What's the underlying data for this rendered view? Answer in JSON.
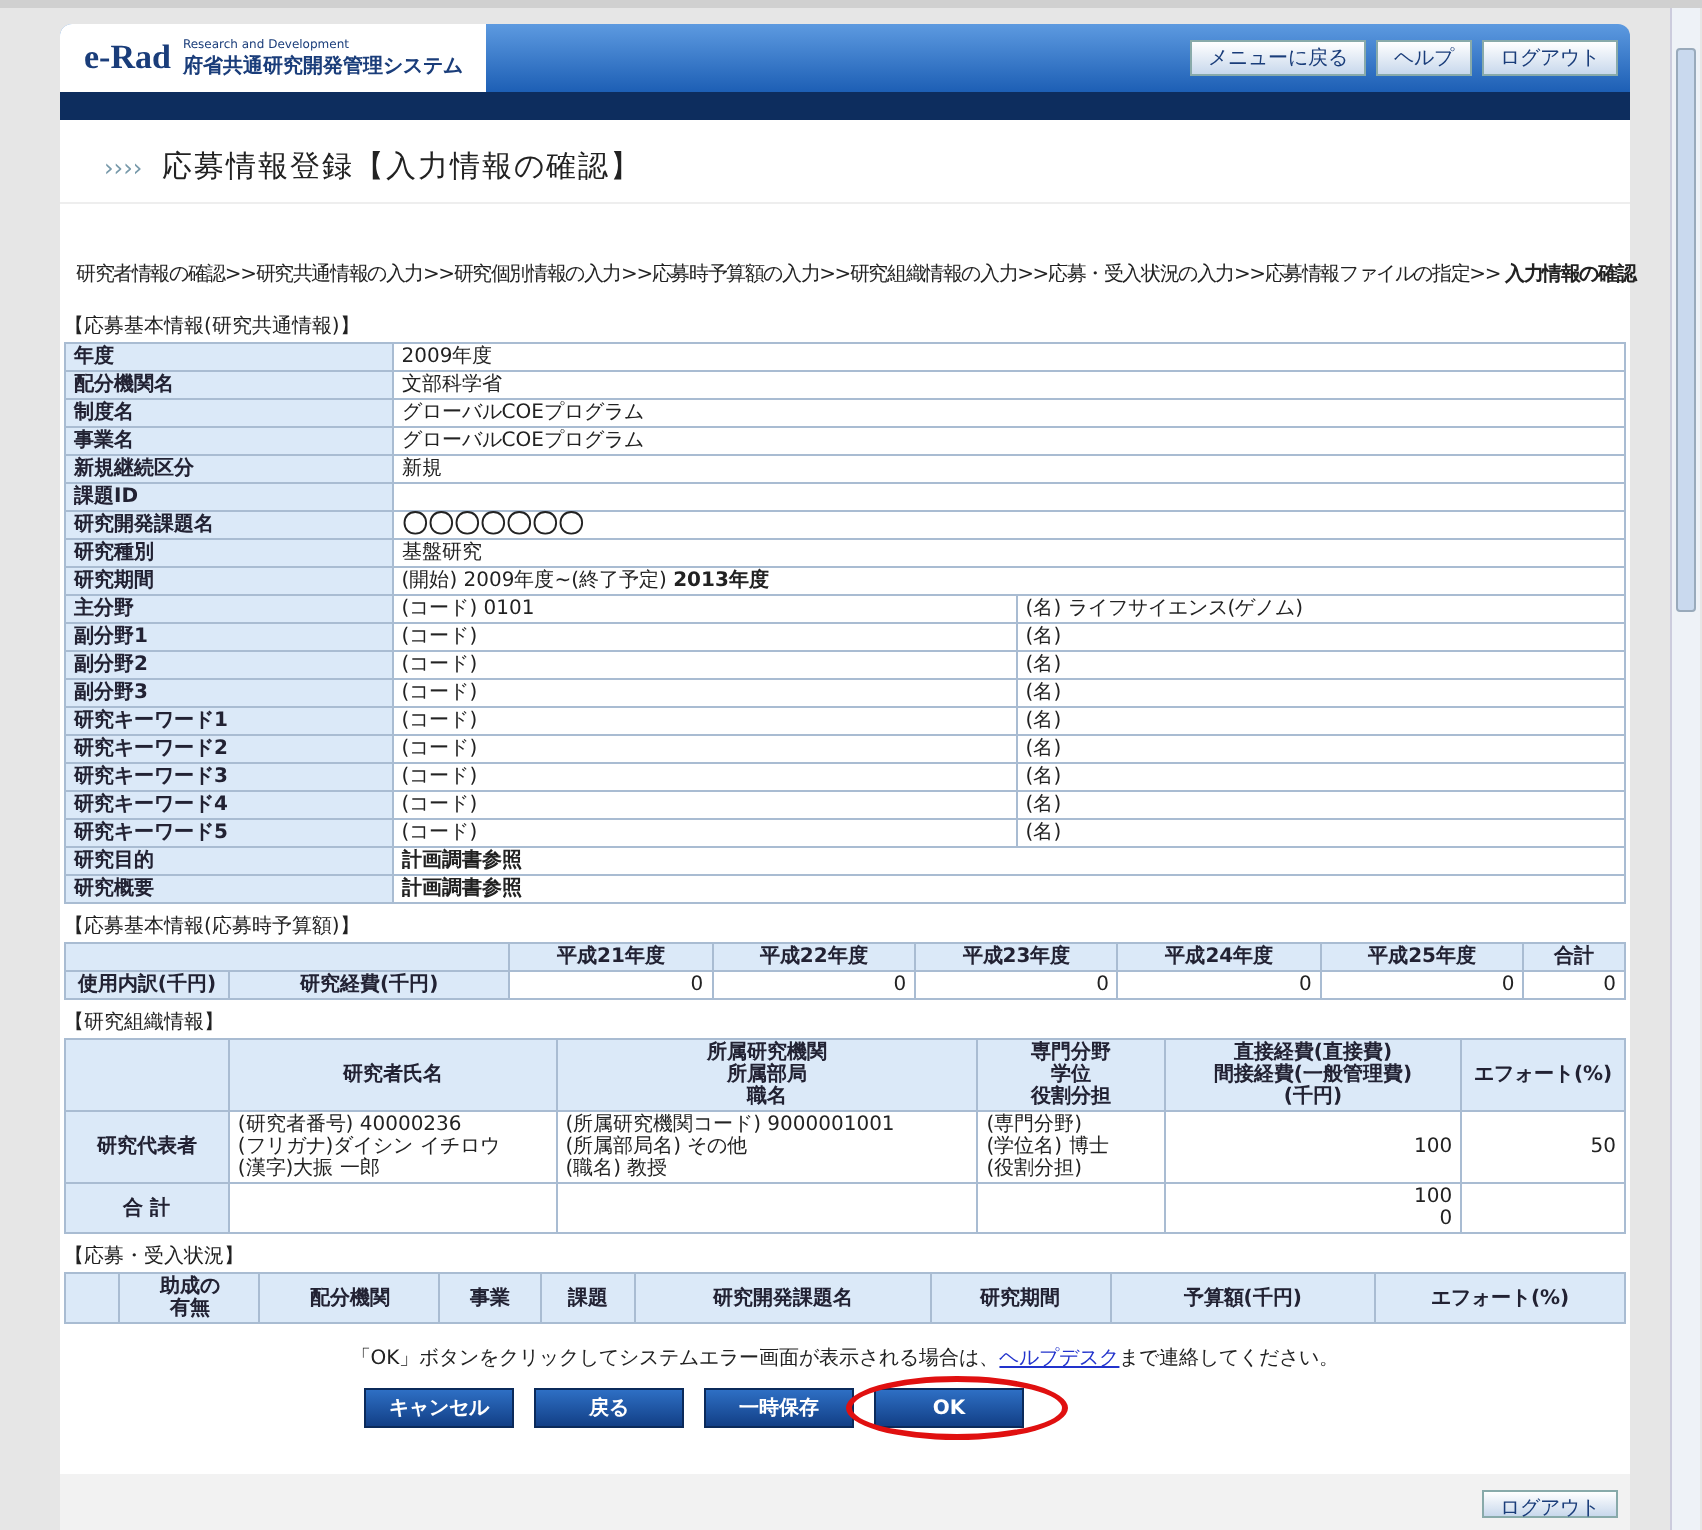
{
  "header": {
    "logo_mark": "e-Rad",
    "logo_tagline": "Research and Development",
    "logo_name": "府省共通研究開発管理システム",
    "nav_buttons": [
      "メニューに戻る",
      "ヘルプ",
      "ログアウト"
    ]
  },
  "title": {
    "prefix": "››››",
    "text": "応募情報登録【入力情報の確認】"
  },
  "breadcrumb": "研究者情報の確認>>研究共通情報の入力>>研究個別情報の入力>>応募時予算額の入力>>研究組織情報の入力>>応募・受入状況の入力>>応募情報ファイルの指定>> **入力情報の確認**",
  "basic_info": {
    "heading": "【応募基本情報(研究共通情報)】",
    "rows": [
      {
        "kind": "single",
        "label": "年度",
        "value": "2009年度"
      },
      {
        "kind": "single",
        "label": "配分機関名",
        "value": "文部科学省"
      },
      {
        "kind": "single",
        "label": "制度名",
        "value": "グローバルCOEプログラム"
      },
      {
        "kind": "single",
        "label": "事業名",
        "value": "グローバルCOEプログラム"
      },
      {
        "kind": "single",
        "label": "新規継続区分",
        "value": "新規"
      },
      {
        "kind": "single",
        "label": "課題ID"
      },
      {
        "kind": "single",
        "label": "研究開発課題名",
        "value": "〇〇〇〇〇〇〇",
        "bold": true,
        "large": true
      },
      {
        "kind": "single",
        "label": "研究種別",
        "value": "基盤研究"
      },
      {
        "kind": "single",
        "label": "研究期間",
        "value": "(開始) 2009年度~(終了予定) **2013年度**"
      },
      {
        "kind": "pair",
        "label": "主分野",
        "value": "(コード) 0101",
        "value_2": "(名) ライフサイエンス(ゲノム)"
      },
      {
        "kind": "pair",
        "label": "副分野1",
        "value": "(コード)",
        "value_2": "(名)"
      },
      {
        "kind": "pair",
        "label": "副分野2",
        "value": "(コード)",
        "value_2": "(名)"
      },
      {
        "kind": "pair",
        "label": "副分野3",
        "value": "(コード)",
        "value_2": "(名)"
      },
      {
        "kind": "pair",
        "label": "研究キーワード1",
        "value": "(コード)",
        "value_2": "(名)"
      },
      {
        "kind": "pair",
        "label": "研究キーワード2",
        "value": "(コード)",
        "value_2": "(名)"
      },
      {
        "kind": "pair",
        "label": "研究キーワード3",
        "value": "(コード)",
        "value_2": "(名)"
      },
      {
        "kind": "pair",
        "label": "研究キーワード4",
        "value": "(コード)",
        "value_2": "(名)"
      },
      {
        "kind": "pair",
        "label": "研究キーワード5",
        "value": "(コード)",
        "value_2": "(名)"
      },
      {
        "kind": "single",
        "label": "研究目的",
        "value": "計画調書参照",
        "bold": true
      },
      {
        "kind": "single",
        "label": "研究概要",
        "value": "計画調書参照",
        "bold": true
      }
    ]
  },
  "budget": {
    "heading": "【応募基本情報(応募時予算額)】",
    "columns": [
      "平成21年度",
      "平成22年度",
      "平成23年度",
      "平成24年度",
      "平成25年度",
      "合計"
    ],
    "row": {
      "label": "使用内訳(千円)",
      "sublabel": "研究経費(千円)",
      "values": [
        "0",
        "0",
        "0",
        "0",
        "0",
        "0"
      ]
    }
  },
  "organization": {
    "heading": "【研究組織情報】",
    "columns": [
      {
        "lines": [
          "研究者氏名"
        ]
      },
      {
        "lines": [
          "所属研究機関",
          "所属部局",
          "職名"
        ]
      },
      {
        "lines": [
          "専門分野",
          "学位",
          "役割分担"
        ]
      },
      {
        "lines": [
          "直接経費(直接費)",
          "間接経費(一般管理費)",
          "(千円)"
        ]
      },
      {
        "lines": [
          "エフォート(%)"
        ]
      }
    ],
    "rows": [
      {
        "label": "研究代表者",
        "name": [
          "(研究者番号) 40000236",
          "(フリガナ)ダイシン イチロウ",
          "(漢字)大振 一郎"
        ],
        "affiliation": [
          "(所属研究機関コード) 9000001001",
          "(所属部局名) その他",
          "(職名) 教授"
        ],
        "field": [
          "(専門分野)",
          "(学位名) 博士",
          "(役割分担)"
        ],
        "cost": [
          "100"
        ],
        "effort": [
          "50"
        ]
      },
      {
        "label": "合 計",
        "cost": [
          "100",
          "0"
        ]
      }
    ]
  },
  "status": {
    "heading": "【応募・受入状況】",
    "columns": [
      {
        "lines": [
          "助成の",
          "有無"
        ]
      },
      {
        "lines": [
          "配分機関"
        ]
      },
      {
        "lines": [
          "事業"
        ]
      },
      {
        "lines": [
          "課題"
        ]
      },
      {
        "lines": [
          "研究開発課題名"
        ]
      },
      {
        "lines": [
          "研究期間"
        ]
      },
      {
        "lines": [
          "予算額(千円)"
        ]
      },
      {
        "lines": [
          "エフォート(%)"
        ]
      }
    ]
  },
  "note": {
    "before": "「OK」ボタンをクリックしてシステムエラー画面が表示される場合は、",
    "link": "ヘルプデスク",
    "after": "まで連絡してください。"
  },
  "buttons": [
    {
      "label": "キャンセル",
      "highlighted": false
    },
    {
      "label": "戻る",
      "highlighted": false
    },
    {
      "label": "一時保存",
      "highlighted": false
    },
    {
      "label": "OK",
      "highlighted": true
    }
  ],
  "footer_button": "ログアウト"
}
